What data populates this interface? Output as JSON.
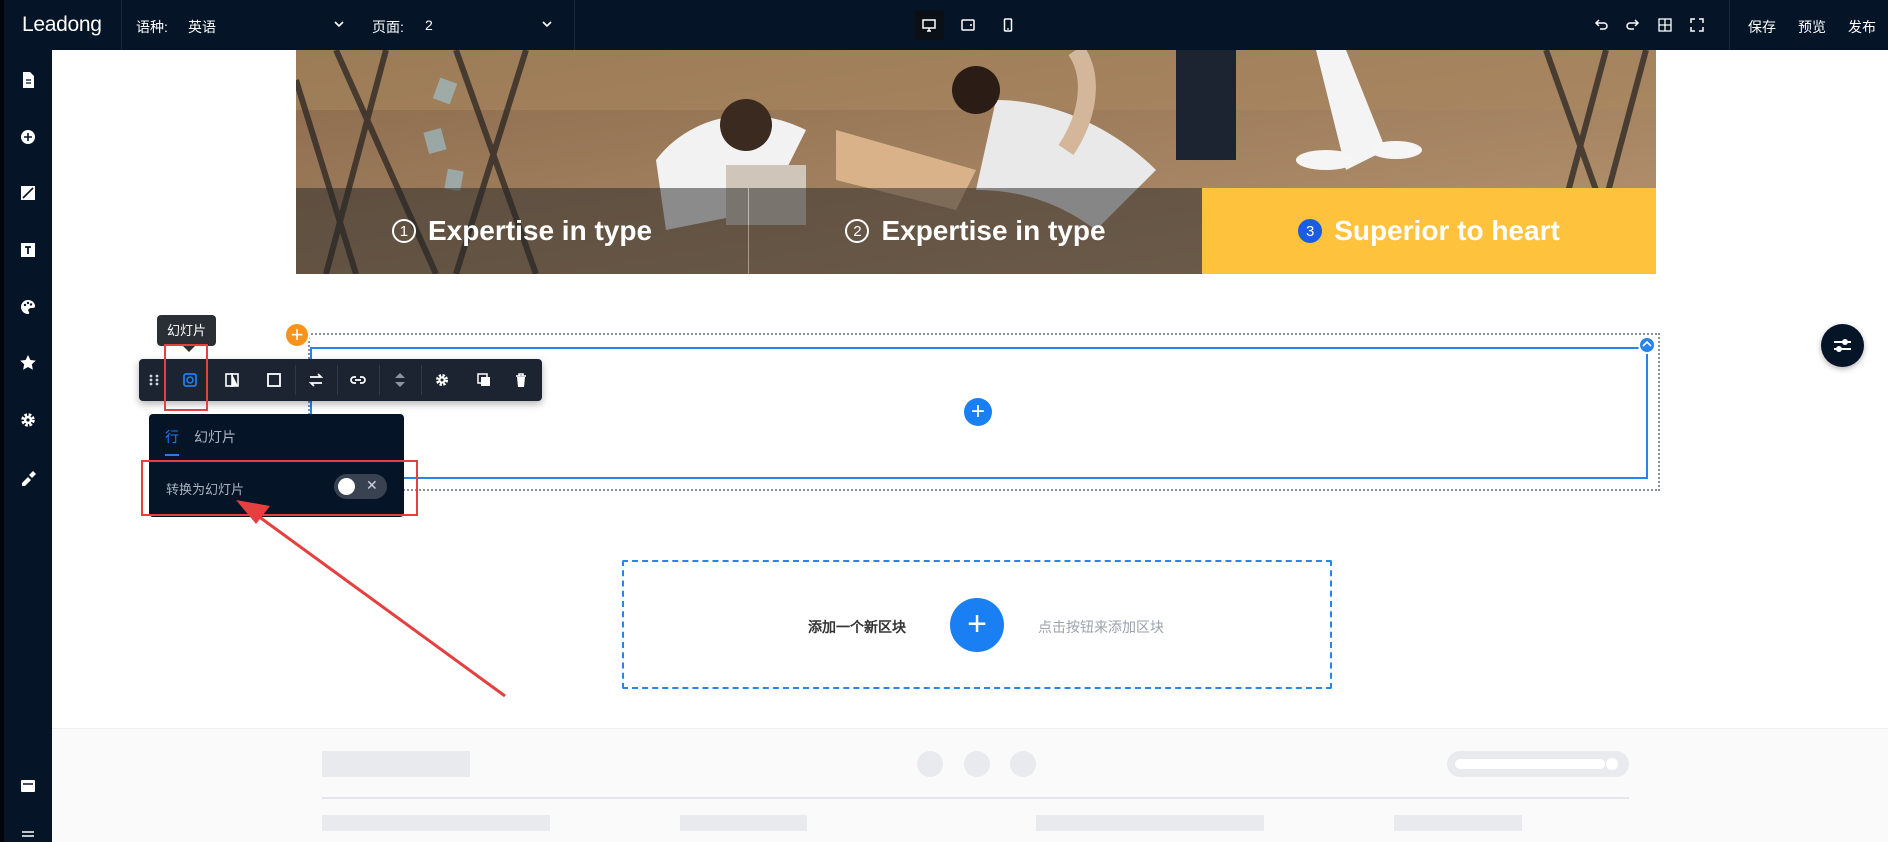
{
  "topbar": {
    "logo": "Leadong",
    "language_label": "语种:",
    "language_value": "英语",
    "page_label": "页面:",
    "page_value": "2",
    "actions": {
      "save": "保存",
      "preview": "预览",
      "publish": "发布"
    }
  },
  "hero": {
    "tabs": [
      {
        "num": "1",
        "label": "Expertise in type",
        "active": false
      },
      {
        "num": "2",
        "label": "Expertise in type",
        "active": false
      },
      {
        "num": "3",
        "label": "Superior to heart",
        "active": true
      }
    ],
    "active_color": "#ffc23d"
  },
  "row_toolbar": {
    "tooltip": "幻灯片",
    "icons": [
      "drag-handle-icon",
      "slideshow-icon",
      "layout-columns-icon",
      "square-icon",
      "swap-icon",
      "link-icon",
      "move-up-down-icon",
      "settings-icon",
      "duplicate-icon",
      "delete-icon"
    ]
  },
  "row_popup": {
    "tabs": [
      "行",
      "幻灯片"
    ],
    "active_tab": "行",
    "convert_label": "转换为幻灯片",
    "toggle_on": false
  },
  "add_block": {
    "title": "添加一个新区块",
    "hint": "点击按钮来添加区块"
  },
  "colors": {
    "topbar": "#051427",
    "accent": "#1a7ff2",
    "orange": "#f6921e",
    "highlight": "#e54040"
  }
}
